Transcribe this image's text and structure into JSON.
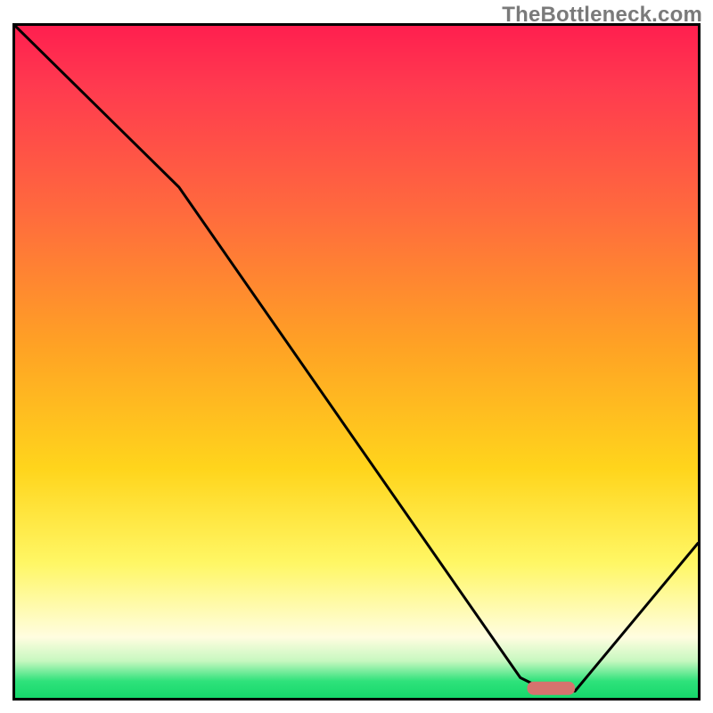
{
  "watermark": "TheBottleneck.com",
  "chart_data": {
    "type": "line",
    "title": "",
    "xlabel": "",
    "ylabel": "",
    "xlim": [
      0,
      100
    ],
    "ylim": [
      0,
      100
    ],
    "grid": false,
    "legend": false,
    "series": [
      {
        "name": "bottleneck-curve",
        "x": [
          0,
          24,
          74,
          78,
          82,
          100
        ],
        "y": [
          100,
          76,
          3,
          1,
          1,
          23
        ],
        "note": "y is approximate percent of plot height (0=bottom, 100=top), read from pixel positions; curve reaches near-zero around x≈78–82 then rises."
      }
    ],
    "marker": {
      "name": "optimal-range-marker",
      "x_start": 75,
      "x_end": 82,
      "y": 1.5,
      "color": "#d6736e"
    },
    "background_gradient_stops": [
      {
        "pos": 0.0,
        "color": "#ff1f4f"
      },
      {
        "pos": 0.28,
        "color": "#ff6b3d"
      },
      {
        "pos": 0.48,
        "color": "#ffa324"
      },
      {
        "pos": 0.66,
        "color": "#ffd51c"
      },
      {
        "pos": 0.91,
        "color": "#fffde0"
      },
      {
        "pos": 0.975,
        "color": "#2fe27b"
      },
      {
        "pos": 1.0,
        "color": "#16d86b"
      }
    ]
  }
}
